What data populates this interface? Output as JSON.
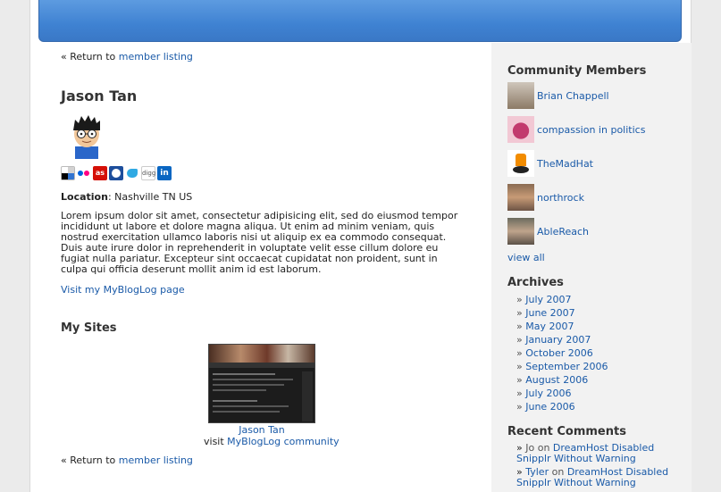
{
  "header": {},
  "return_link": {
    "prefix": "« Return to",
    "label": "member listing"
  },
  "profile": {
    "name": "Jason Tan",
    "location_label": "Location",
    "location_value": ": Nashville TN US",
    "bio": "Lorem ipsum dolor sit amet, consectetur adipisicing elit, sed do eiusmod tempor incididunt ut labore et dolore magna aliqua. Ut enim ad minim veniam, quis nostrud exercitation ullamco laboris nisi ut aliquip ex ea commodo consequat. Duis aute irure dolor in reprehenderit in voluptate velit esse cillum dolore eu fugiat nulla pariatur. Excepteur sint occaecat cupidatat non proident, sunt in culpa qui officia deserunt mollit anim id est laborum.",
    "mybloglog_link": "Visit my MyBlogLog page",
    "service_icons": [
      "delicious-icon",
      "flickr-icon",
      "lastfm-icon",
      "myspace-icon",
      "twitter-icon",
      "digg-icon",
      "linkedin-icon"
    ]
  },
  "my_sites": {
    "title": "My Sites",
    "site_name": "Jason Tan",
    "visit_prefix": "visit",
    "visit_link": "MyBlogLog community"
  },
  "sidebar": {
    "community_title": "Community Members",
    "members": [
      {
        "name": "Brian Chappell"
      },
      {
        "name": "compassion in politics"
      },
      {
        "name": "TheMadHat"
      },
      {
        "name": "northrock"
      },
      {
        "name": "AbleReach"
      }
    ],
    "view_all": "view all",
    "archives_title": "Archives",
    "archives": [
      "July 2007",
      "June 2007",
      "May 2007",
      "January 2007",
      "October 2006",
      "September 2006",
      "August 2006",
      "July 2006",
      "June 2006"
    ],
    "recent_comments_title": "Recent Comments",
    "comments": [
      {
        "author": "Jo",
        "on": "on",
        "post": "DreamHost Disabled Snipplr Without Warning"
      },
      {
        "author": "Tyler",
        "on": "on",
        "post": "DreamHost Disabled Snipplr Without Warning"
      }
    ]
  },
  "colors": {
    "header_blue": "#3f82d2",
    "link": "#1a5aa8",
    "sidebar_bg": "#f2f2f2"
  }
}
